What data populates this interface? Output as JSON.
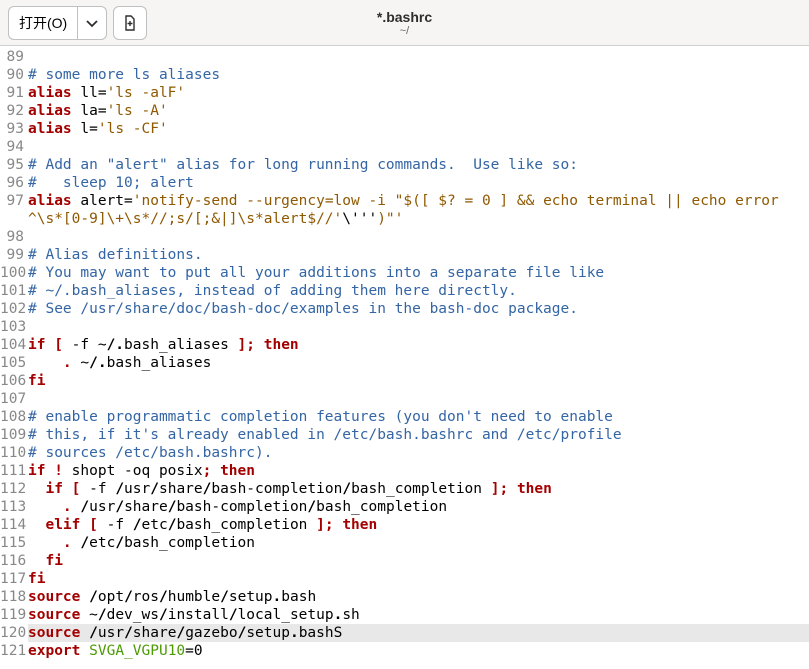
{
  "header": {
    "open_label": "打开(O)",
    "title": "*.bashrc",
    "subtitle": "~/"
  },
  "lines": [
    {
      "n": 89,
      "segs": []
    },
    {
      "n": 90,
      "segs": [
        {
          "c": "cmt",
          "t": "# some more ls aliases"
        }
      ]
    },
    {
      "n": 91,
      "segs": [
        {
          "c": "kw",
          "t": "alias"
        },
        {
          "c": "plain",
          "t": " ll="
        },
        {
          "c": "str",
          "t": "'ls -alF'"
        }
      ]
    },
    {
      "n": 92,
      "segs": [
        {
          "c": "kw",
          "t": "alias"
        },
        {
          "c": "plain",
          "t": " la="
        },
        {
          "c": "str",
          "t": "'ls -A'"
        }
      ]
    },
    {
      "n": 93,
      "segs": [
        {
          "c": "kw",
          "t": "alias"
        },
        {
          "c": "plain",
          "t": " l="
        },
        {
          "c": "str",
          "t": "'ls -CF'"
        }
      ]
    },
    {
      "n": 94,
      "segs": []
    },
    {
      "n": 95,
      "segs": [
        {
          "c": "cmt",
          "t": "# Add an \"alert\" alias for long running commands.  Use like so:"
        }
      ]
    },
    {
      "n": 96,
      "segs": [
        {
          "c": "cmt",
          "t": "#   sleep 10; alert"
        }
      ]
    },
    {
      "n": 97,
      "segs": [
        {
          "c": "kw",
          "t": "alias"
        },
        {
          "c": "plain",
          "t": " alert="
        },
        {
          "c": "str",
          "t": "'notify-send --urgency=low -i \"$([ $? = 0 ] && echo terminal || echo error"
        }
      ]
    },
    {
      "n": "",
      "segs": [
        {
          "c": "str",
          "t": "^\\s*[0-9]\\+\\s*//;s/[;&|]\\s*alert$//'"
        },
        {
          "c": "plain",
          "t": "\\'''"
        },
        {
          "c": "str",
          "t": ")\"'"
        }
      ]
    },
    {
      "n": 98,
      "segs": []
    },
    {
      "n": 99,
      "segs": [
        {
          "c": "cmt",
          "t": "# Alias definitions."
        }
      ]
    },
    {
      "n": 100,
      "segs": [
        {
          "c": "cmt",
          "t": "# You may want to put all your additions into a separate file like"
        }
      ]
    },
    {
      "n": 101,
      "segs": [
        {
          "c": "cmt",
          "t": "# ~/.bash_aliases, instead of adding them here directly."
        }
      ]
    },
    {
      "n": 102,
      "segs": [
        {
          "c": "cmt",
          "t": "# See /usr/share/doc/bash-doc/examples in the bash-doc package."
        }
      ]
    },
    {
      "n": 103,
      "segs": []
    },
    {
      "n": 104,
      "segs": [
        {
          "c": "kw",
          "t": "if ["
        },
        {
          "c": "plain",
          "t": " -f ~"
        },
        {
          "c": "path",
          "t": "/."
        },
        {
          "c": "plain",
          "t": "bash_aliases "
        },
        {
          "c": "kw",
          "t": "]; then"
        }
      ]
    },
    {
      "n": 105,
      "segs": [
        {
          "c": "plain",
          "t": "    "
        },
        {
          "c": "kw",
          "t": "."
        },
        {
          "c": "plain",
          "t": " ~"
        },
        {
          "c": "path",
          "t": "/."
        },
        {
          "c": "plain",
          "t": "bash_aliases"
        }
      ]
    },
    {
      "n": 106,
      "segs": [
        {
          "c": "kw",
          "t": "fi"
        }
      ]
    },
    {
      "n": 107,
      "segs": []
    },
    {
      "n": 108,
      "segs": [
        {
          "c": "cmt",
          "t": "# enable programmatic completion features (you don't need to enable"
        }
      ]
    },
    {
      "n": 109,
      "segs": [
        {
          "c": "cmt",
          "t": "# this, if it's already enabled in /etc/bash.bashrc and /etc/profile"
        }
      ]
    },
    {
      "n": 110,
      "segs": [
        {
          "c": "cmt",
          "t": "# sources /etc/bash.bashrc)."
        }
      ]
    },
    {
      "n": 111,
      "segs": [
        {
          "c": "kw",
          "t": "if ! "
        },
        {
          "c": "plain",
          "t": "shopt -oq posix"
        },
        {
          "c": "kw",
          "t": "; then"
        }
      ]
    },
    {
      "n": 112,
      "segs": [
        {
          "c": "plain",
          "t": "  "
        },
        {
          "c": "kw",
          "t": "if ["
        },
        {
          "c": "plain",
          "t": " -f "
        },
        {
          "c": "path",
          "t": "/"
        },
        {
          "c": "plain",
          "t": "usr"
        },
        {
          "c": "path",
          "t": "/"
        },
        {
          "c": "plain",
          "t": "share"
        },
        {
          "c": "path",
          "t": "/"
        },
        {
          "c": "plain",
          "t": "bash-completion"
        },
        {
          "c": "path",
          "t": "/"
        },
        {
          "c": "plain",
          "t": "bash_completion "
        },
        {
          "c": "kw",
          "t": "]; then"
        }
      ]
    },
    {
      "n": 113,
      "segs": [
        {
          "c": "plain",
          "t": "    "
        },
        {
          "c": "kw",
          "t": "."
        },
        {
          "c": "plain",
          "t": " "
        },
        {
          "c": "path",
          "t": "/"
        },
        {
          "c": "plain",
          "t": "usr"
        },
        {
          "c": "path",
          "t": "/"
        },
        {
          "c": "plain",
          "t": "share"
        },
        {
          "c": "path",
          "t": "/"
        },
        {
          "c": "plain",
          "t": "bash-completion"
        },
        {
          "c": "path",
          "t": "/"
        },
        {
          "c": "plain",
          "t": "bash_completion"
        }
      ]
    },
    {
      "n": 114,
      "segs": [
        {
          "c": "plain",
          "t": "  "
        },
        {
          "c": "kw",
          "t": "elif ["
        },
        {
          "c": "plain",
          "t": " -f "
        },
        {
          "c": "path",
          "t": "/"
        },
        {
          "c": "plain",
          "t": "etc"
        },
        {
          "c": "path",
          "t": "/"
        },
        {
          "c": "plain",
          "t": "bash_completion "
        },
        {
          "c": "kw",
          "t": "]; then"
        }
      ]
    },
    {
      "n": 115,
      "segs": [
        {
          "c": "plain",
          "t": "    "
        },
        {
          "c": "kw",
          "t": "."
        },
        {
          "c": "plain",
          "t": " "
        },
        {
          "c": "path",
          "t": "/"
        },
        {
          "c": "plain",
          "t": "etc"
        },
        {
          "c": "path",
          "t": "/"
        },
        {
          "c": "plain",
          "t": "bash_completion"
        }
      ]
    },
    {
      "n": 116,
      "segs": [
        {
          "c": "plain",
          "t": "  "
        },
        {
          "c": "kw",
          "t": "fi"
        }
      ]
    },
    {
      "n": 117,
      "segs": [
        {
          "c": "kw",
          "t": "fi"
        }
      ]
    },
    {
      "n": 118,
      "segs": [
        {
          "c": "kw",
          "t": "source"
        },
        {
          "c": "plain",
          "t": " "
        },
        {
          "c": "path",
          "t": "/"
        },
        {
          "c": "plain",
          "t": "opt"
        },
        {
          "c": "path",
          "t": "/"
        },
        {
          "c": "plain",
          "t": "ros"
        },
        {
          "c": "path",
          "t": "/"
        },
        {
          "c": "plain",
          "t": "humble"
        },
        {
          "c": "path",
          "t": "/"
        },
        {
          "c": "plain",
          "t": "setup"
        },
        {
          "c": "path",
          "t": "."
        },
        {
          "c": "plain",
          "t": "bash"
        }
      ]
    },
    {
      "n": 119,
      "segs": [
        {
          "c": "kw",
          "t": "source"
        },
        {
          "c": "plain",
          "t": " ~"
        },
        {
          "c": "path",
          "t": "/"
        },
        {
          "c": "plain",
          "t": "dev_ws"
        },
        {
          "c": "path",
          "t": "/"
        },
        {
          "c": "plain",
          "t": "install"
        },
        {
          "c": "path",
          "t": "/"
        },
        {
          "c": "plain",
          "t": "local_setup"
        },
        {
          "c": "path",
          "t": "."
        },
        {
          "c": "plain",
          "t": "sh"
        }
      ]
    },
    {
      "n": 120,
      "hl": true,
      "segs": [
        {
          "c": "kw",
          "t": "source"
        },
        {
          "c": "plain",
          "t": " "
        },
        {
          "c": "path",
          "t": "/"
        },
        {
          "c": "plain",
          "t": "usr"
        },
        {
          "c": "path",
          "t": "/"
        },
        {
          "c": "plain",
          "t": "share"
        },
        {
          "c": "path",
          "t": "/"
        },
        {
          "c": "plain",
          "t": "gazebo"
        },
        {
          "c": "path",
          "t": "/"
        },
        {
          "c": "plain",
          "t": "setup"
        },
        {
          "c": "path",
          "t": "."
        },
        {
          "c": "plain",
          "t": "bashS"
        }
      ]
    },
    {
      "n": 121,
      "segs": [
        {
          "c": "kw",
          "t": "export"
        },
        {
          "c": "plain",
          "t": " "
        },
        {
          "c": "var",
          "t": "SVGA_VGPU10"
        },
        {
          "c": "plain",
          "t": "=0"
        }
      ]
    }
  ]
}
